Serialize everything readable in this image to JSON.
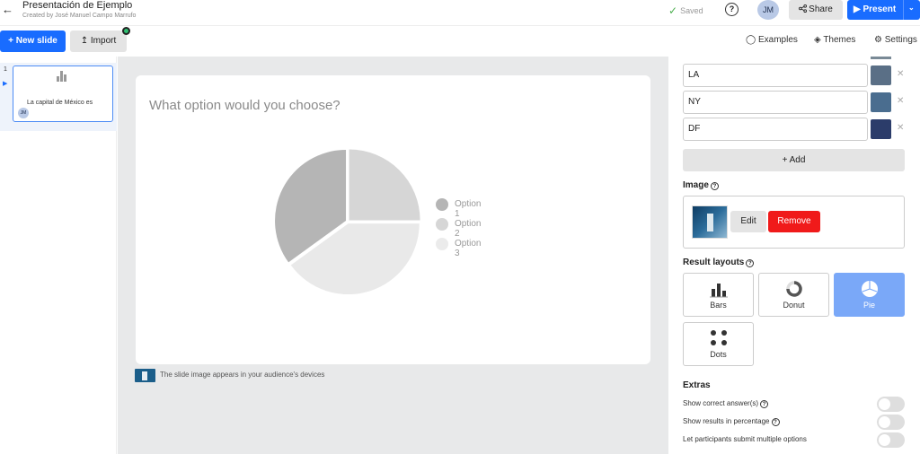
{
  "header": {
    "back_icon": "arrow-left-icon",
    "title": "Presentación de Ejemplo",
    "subtitle": "Created by José Manuel Campo Marrufo",
    "saved_label": "Saved",
    "avatar_initials": "JM",
    "share_label": "Share",
    "present_label": "Present",
    "accent_color": "#196cff"
  },
  "toolbar": {
    "new_slide_label": "+ New slide",
    "import_label": "Import",
    "examples_label": "Examples",
    "themes_label": "Themes",
    "settings_label": "Settings"
  },
  "slides": [
    {
      "number": "1",
      "title": "La capital de México es",
      "avatar": "JM"
    }
  ],
  "slide": {
    "question": "What option would you choose?",
    "caption": "The slide image appears in your audience's devices"
  },
  "chart_data": {
    "type": "pie",
    "categories": [
      "Option 1",
      "Option 2",
      "Option 3"
    ],
    "values": [
      25,
      40,
      35
    ],
    "colors": [
      "#d6d6d6",
      "#e9e9e9",
      "#b5b5b5"
    ],
    "legend_colors": [
      "#b5b5b5",
      "#d6d6d6",
      "#ebebeb"
    ],
    "legend_position": "right"
  },
  "options": [
    {
      "label": "LA",
      "image_color": "#5a6f86"
    },
    {
      "label": "NY",
      "image_color": "#4a6d8f"
    },
    {
      "label": "DF",
      "image_color": "#2b3c6a"
    }
  ],
  "right_panel": {
    "add_label": "+ Add",
    "image_label": "Image",
    "edit_label": "Edit",
    "remove_label": "Remove",
    "result_layouts_label": "Result layouts",
    "layouts": [
      "Bars",
      "Donut",
      "Pie",
      "Dots"
    ],
    "active_layout": "Pie",
    "extras_label": "Extras",
    "extras": [
      {
        "label": "Show correct answer(s)",
        "has_help": true,
        "on": false
      },
      {
        "label": "Show results in percentage",
        "has_help": true,
        "on": false
      },
      {
        "label": "Let participants submit multiple options",
        "has_help": false,
        "on": false
      }
    ]
  }
}
